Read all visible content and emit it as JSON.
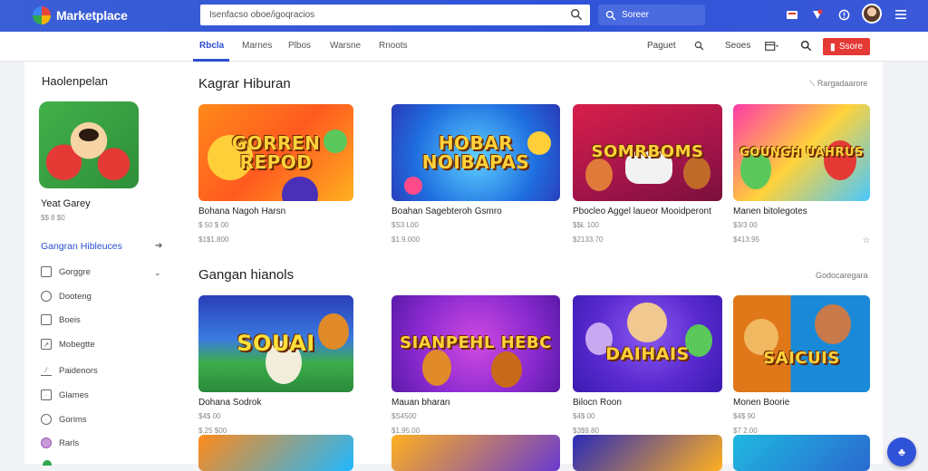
{
  "app": {
    "name": "Marketplace"
  },
  "colors": {
    "brand": "#2f53d8",
    "accent": "#e53935",
    "link": "#2b4ed0"
  },
  "search": {
    "placeholder": "Isenfacso oboe/igoqracios"
  },
  "secondary_search": {
    "label": "Soreer"
  },
  "tabs": [
    {
      "label": "Rbcla"
    },
    {
      "label": "Marnes"
    },
    {
      "label": "Plbos"
    },
    {
      "label": "Warsne"
    },
    {
      "label": "Rnoots"
    }
  ],
  "subbar_right": {
    "link1": "Paguet",
    "link2": "Seoes",
    "join_label": "Ssore"
  },
  "sidebar": {
    "title": "Haolenpelan",
    "profile_name": "Yeat Garey",
    "profile_sub": "$$ 8 $0",
    "section": "Gangran Hibleuces",
    "items": [
      {
        "label": "Gorggre",
        "icon": "square-icon"
      },
      {
        "label": "Dooteng",
        "icon": "circle-info-icon"
      },
      {
        "label": "Boeis",
        "icon": "inbox-icon"
      },
      {
        "label": "Mobegtte",
        "icon": "chart-icon"
      },
      {
        "label": "Paidenors",
        "icon": "edit-icon"
      },
      {
        "label": "Glames",
        "icon": "box-icon"
      },
      {
        "label": "Gorims",
        "icon": "clock-icon"
      },
      {
        "label": "Rarls",
        "icon": "shield-icon"
      }
    ]
  },
  "sections": [
    {
      "title": "Kagrar Hiburan",
      "more": "Rargadaarore",
      "cards": [
        {
          "art_text": "GORREN REPOD",
          "name": "Bohana Nagoh Harsn",
          "line1": "$ 50 $ 00",
          "line2": "$1$1.800"
        },
        {
          "art_text": "HOBAR NOIBAPAS",
          "name": "Boahan Sagebteroh Gsmro",
          "line1": "$S3 L00",
          "line2": "$1.9.000"
        },
        {
          "art_text": "SOMRBOMS",
          "name": "Pbocleo Aggel laueor Mooidperont",
          "line1": "$$Ł 100",
          "line2": "$2133.70"
        },
        {
          "art_text": "GOUNGH UAHRUS",
          "name": "Manen bitolegotes",
          "line1": "$3/3 00",
          "line2": "$413.95"
        }
      ]
    },
    {
      "title": "Gangan hianols",
      "more": "Godocaregara",
      "cards": [
        {
          "art_text": "SOUAI",
          "name": "Dohana Sodrok",
          "line1": "$4$ 00",
          "line2": "$.25 $00"
        },
        {
          "art_text": "SIANPEHL HEBC",
          "name": "Mauan bharan",
          "line1": "$S4500",
          "line2": "$1.95.00"
        },
        {
          "art_text": "DAIHAIS",
          "name": "Bilocn Roon",
          "line1": "$4$ 00",
          "line2": "$3$9.80"
        },
        {
          "art_text": "SAICUIS",
          "name": "Monen Boorie",
          "line1": "$4$ 90",
          "line2": "$7 2.00"
        }
      ]
    }
  ]
}
